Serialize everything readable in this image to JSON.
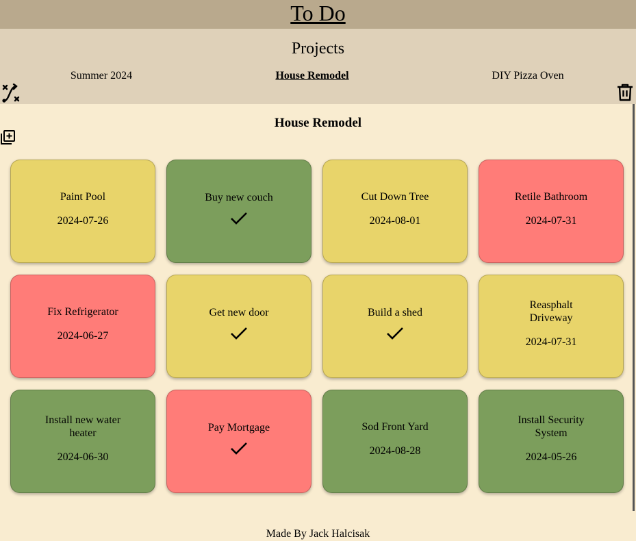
{
  "header": {
    "title": "To Do"
  },
  "projects": {
    "heading": "Projects",
    "tabs": [
      {
        "label": "Summer 2024",
        "active": false
      },
      {
        "label": "House Remodel",
        "active": true
      },
      {
        "label": "DIY Pizza Oven",
        "active": false
      }
    ],
    "icons": {
      "left": "shuffle-x-icon",
      "right": "trash-icon"
    }
  },
  "board": {
    "title": "House Remodel",
    "add_icon": "add-task-icon",
    "colors": {
      "yellow": "#e8d46a",
      "green": "#7c9e5c",
      "red": "#ff7c78"
    },
    "tasks": [
      {
        "name": "Paint Pool",
        "date": "2024-07-26",
        "status": "yellow",
        "completed": false
      },
      {
        "name": "Buy new couch",
        "date": "",
        "status": "green",
        "completed": true
      },
      {
        "name": "Cut Down Tree",
        "date": "2024-08-01",
        "status": "yellow",
        "completed": false
      },
      {
        "name": "Retile Bathroom",
        "date": "2024-07-31",
        "status": "red",
        "completed": false
      },
      {
        "name": "Fix Refrigerator",
        "date": "2024-06-27",
        "status": "red",
        "completed": false
      },
      {
        "name": "Get new door",
        "date": "",
        "status": "yellow",
        "completed": true
      },
      {
        "name": "Build a shed",
        "date": "",
        "status": "yellow",
        "completed": true
      },
      {
        "name": "Reasphalt Driveway",
        "date": "2024-07-31",
        "status": "yellow",
        "completed": false
      },
      {
        "name": "Install new water heater",
        "date": "2024-06-30",
        "status": "green",
        "completed": false
      },
      {
        "name": "Pay Mortgage",
        "date": "",
        "status": "red",
        "completed": true
      },
      {
        "name": "Sod Front Yard",
        "date": "2024-08-28",
        "status": "green",
        "completed": false
      },
      {
        "name": "Install Security System",
        "date": "2024-05-26",
        "status": "green",
        "completed": false
      }
    ]
  },
  "footer": {
    "text": "Made By Jack Halcisak"
  }
}
